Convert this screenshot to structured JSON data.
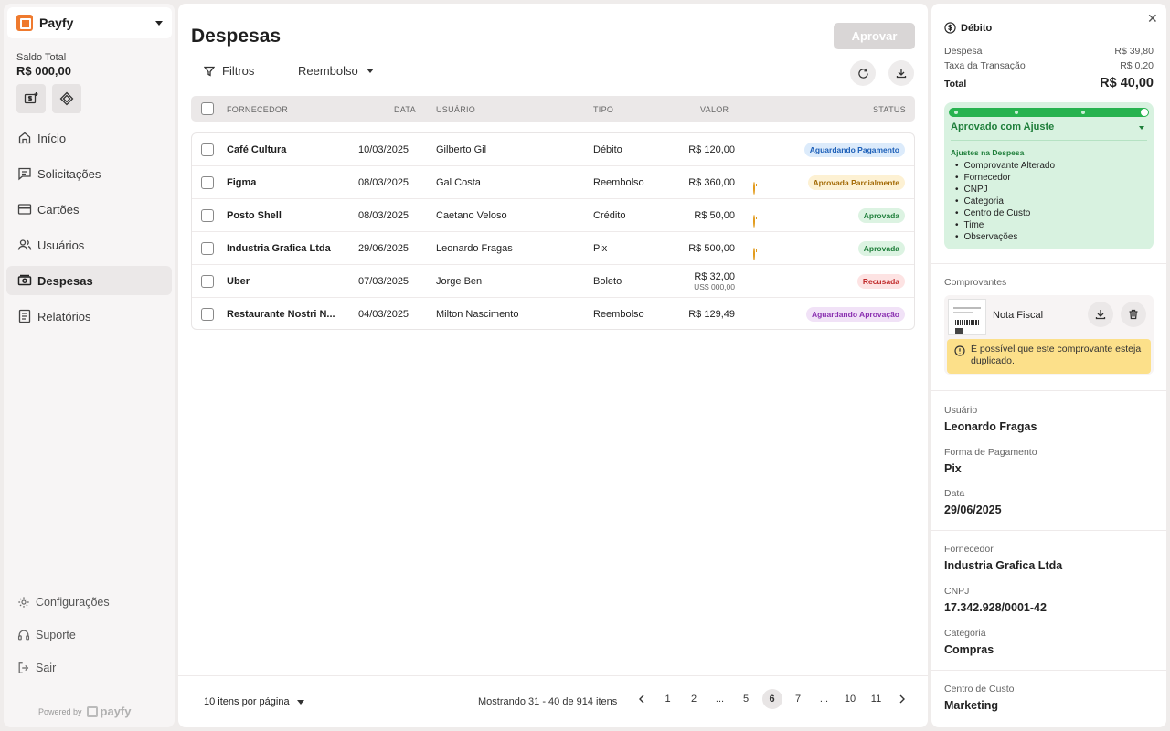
{
  "brand": {
    "name": "Payfy"
  },
  "balance": {
    "label": "Saldo Total",
    "value": "R$ 000,00"
  },
  "nav": [
    {
      "label": "Início",
      "icon": "home-icon"
    },
    {
      "label": "Solicitações",
      "icon": "message-icon"
    },
    {
      "label": "Cartões",
      "icon": "card-icon"
    },
    {
      "label": "Usuários",
      "icon": "users-icon"
    },
    {
      "label": "Despesas",
      "icon": "cash-icon",
      "active": true
    },
    {
      "label": "Relatórios",
      "icon": "report-icon"
    }
  ],
  "bottom_nav": [
    {
      "label": "Configurações",
      "icon": "gear-icon"
    },
    {
      "label": "Suporte",
      "icon": "headset-icon"
    },
    {
      "label": "Sair",
      "icon": "logout-icon"
    }
  ],
  "powered": {
    "label": "Powered by",
    "name": "payfy"
  },
  "main": {
    "title": "Despesas",
    "approve_label": "Aprovar",
    "filters_label": "Filtros",
    "type_filter": "Reembolso"
  },
  "table": {
    "headers": {
      "vendor": "FORNECEDOR",
      "date": "DATA",
      "user": "USUÁRIO",
      "type": "TIPO",
      "value": "VALOR",
      "status": "STATUS"
    },
    "rows": [
      {
        "vendor": "Café Cultura",
        "date": "10/03/2025",
        "user": "Gilberto Gil",
        "type": "Débito",
        "value": "R$ 120,00",
        "sub": "",
        "warn": false,
        "status": "Aguardando Pagamento",
        "status_bg": "#dcebfb",
        "status_fg": "#1c5fb8"
      },
      {
        "vendor": "Figma",
        "date": "08/03/2025",
        "user": "Gal Costa",
        "type": "Reembolso",
        "value": "R$ 360,00",
        "sub": "",
        "warn": true,
        "status": "Aprovada Parcialmente",
        "status_bg": "#fdf1d3",
        "status_fg": "#a36a06"
      },
      {
        "vendor": "Posto Shell",
        "date": "08/03/2025",
        "user": "Caetano Veloso",
        "type": "Crédito",
        "value": "R$ 50,00",
        "sub": "",
        "warn": true,
        "status": "Aprovada",
        "status_bg": "#dcf3e2",
        "status_fg": "#1e7e3a"
      },
      {
        "vendor": "Industria Grafica Ltda",
        "date": "29/06/2025",
        "user": "Leonardo Fragas",
        "type": "Pix",
        "value": "R$ 500,00",
        "sub": "",
        "warn": true,
        "status": "Aprovada",
        "status_bg": "#dcf3e2",
        "status_fg": "#1e7e3a"
      },
      {
        "vendor": "Uber",
        "date": "07/03/2025",
        "user": "Jorge Ben",
        "type": "Boleto",
        "value": "R$ 32,00",
        "sub": "US$ 000,00",
        "warn": false,
        "status": "Recusada",
        "status_bg": "#fde3e3",
        "status_fg": "#c02a2a"
      },
      {
        "vendor": "Restaurante Nostri N...",
        "date": "04/03/2025",
        "user": "Milton Nascimento",
        "type": "Reembolso",
        "value": "R$ 129,49",
        "sub": "",
        "warn": false,
        "status": "Aguardando Aprovação",
        "status_bg": "#f1e2f7",
        "status_fg": "#8a2fb0"
      }
    ]
  },
  "footer": {
    "per_page": "10 itens por página",
    "showing": "Mostrando 31 - 40 de 914 itens",
    "pages": [
      "1",
      "2",
      "...",
      "5",
      "6",
      "7",
      "...",
      "10",
      "11"
    ],
    "active_page": "6"
  },
  "detail": {
    "payment_type": "Débito",
    "expense_label": "Despesa",
    "expense_value": "R$ 39,80",
    "fee_label": "Taxa da Transação",
    "fee_value": "R$ 0,20",
    "total_label": "Total",
    "total_value": "R$ 40,00",
    "status": "Aprovado com Ajuste",
    "adjust_title": "Ajustes na Despesa",
    "adjustments": [
      "Comprovante Alterado",
      "Fornecedor",
      "CNPJ",
      "Categoria",
      "Centro de Custo",
      "Time",
      "Observações"
    ],
    "receipts_label": "Comprovantes",
    "receipt_name": "Nota Fiscal",
    "duplicate_warning": "É possível que este comprovante esteja duplicado.",
    "user_label": "Usuário",
    "user_value": "Leonardo Fragas",
    "payment_label": "Forma de Pagamento",
    "payment_value": "Pix",
    "date_label": "Data",
    "date_value": "29/06/2025",
    "vendor_label": "Fornecedor",
    "vendor_value": "Industria Grafica Ltda",
    "cnpj_label": "CNPJ",
    "cnpj_value": "17.342.928/0001-42",
    "category_label": "Categoria",
    "category_value": "Compras",
    "cost_center_label": "Centro de Custo",
    "cost_center_value": "Marketing"
  },
  "colors": {
    "brand": "#ef7a2e",
    "approved_green": "#27b34f",
    "warning": "#fce08a"
  }
}
